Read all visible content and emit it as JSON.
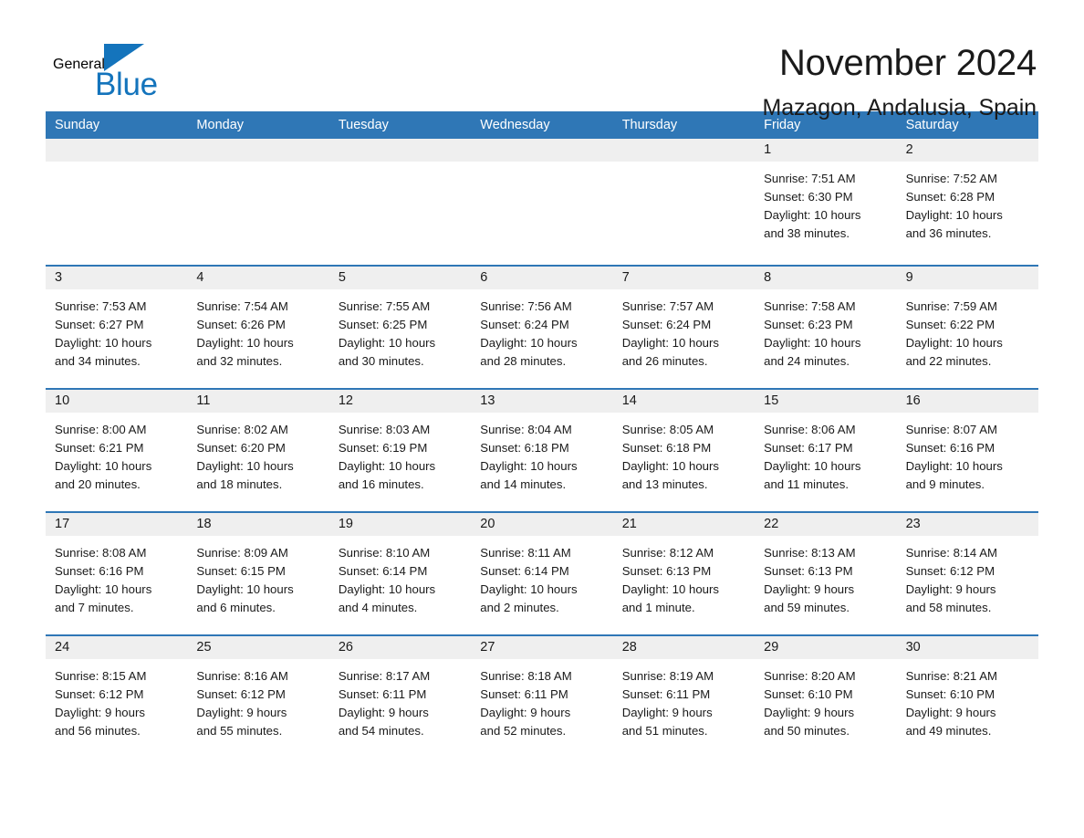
{
  "brand": {
    "name_part1": "General",
    "name_part2": "Blue",
    "triangle_color": "#1474bc",
    "logo_icon": "triangle-flag-icon"
  },
  "header": {
    "title": "November 2024",
    "subtitle": "Mazagon, Andalusia, Spain"
  },
  "theme": {
    "header_blue": "#2f77b6",
    "band_gray": "#efefef",
    "text_color": "#1a1a1a",
    "brand_blue": "#1474bc"
  },
  "weekday_headers": [
    "Sunday",
    "Monday",
    "Tuesday",
    "Wednesday",
    "Thursday",
    "Friday",
    "Saturday"
  ],
  "weeks": [
    [
      {
        "day": "",
        "empty": true,
        "lines": []
      },
      {
        "day": "",
        "empty": true,
        "lines": []
      },
      {
        "day": "",
        "empty": true,
        "lines": []
      },
      {
        "day": "",
        "empty": true,
        "lines": []
      },
      {
        "day": "",
        "empty": true,
        "lines": []
      },
      {
        "day": "1",
        "empty": false,
        "lines": [
          "Sunrise: 7:51 AM",
          "Sunset: 6:30 PM",
          "Daylight: 10 hours",
          "and 38 minutes."
        ]
      },
      {
        "day": "2",
        "empty": false,
        "lines": [
          "Sunrise: 7:52 AM",
          "Sunset: 6:28 PM",
          "Daylight: 10 hours",
          "and 36 minutes."
        ]
      }
    ],
    [
      {
        "day": "3",
        "empty": false,
        "lines": [
          "Sunrise: 7:53 AM",
          "Sunset: 6:27 PM",
          "Daylight: 10 hours",
          "and 34 minutes."
        ]
      },
      {
        "day": "4",
        "empty": false,
        "lines": [
          "Sunrise: 7:54 AM",
          "Sunset: 6:26 PM",
          "Daylight: 10 hours",
          "and 32 minutes."
        ]
      },
      {
        "day": "5",
        "empty": false,
        "lines": [
          "Sunrise: 7:55 AM",
          "Sunset: 6:25 PM",
          "Daylight: 10 hours",
          "and 30 minutes."
        ]
      },
      {
        "day": "6",
        "empty": false,
        "lines": [
          "Sunrise: 7:56 AM",
          "Sunset: 6:24 PM",
          "Daylight: 10 hours",
          "and 28 minutes."
        ]
      },
      {
        "day": "7",
        "empty": false,
        "lines": [
          "Sunrise: 7:57 AM",
          "Sunset: 6:24 PM",
          "Daylight: 10 hours",
          "and 26 minutes."
        ]
      },
      {
        "day": "8",
        "empty": false,
        "lines": [
          "Sunrise: 7:58 AM",
          "Sunset: 6:23 PM",
          "Daylight: 10 hours",
          "and 24 minutes."
        ]
      },
      {
        "day": "9",
        "empty": false,
        "lines": [
          "Sunrise: 7:59 AM",
          "Sunset: 6:22 PM",
          "Daylight: 10 hours",
          "and 22 minutes."
        ]
      }
    ],
    [
      {
        "day": "10",
        "empty": false,
        "lines": [
          "Sunrise: 8:00 AM",
          "Sunset: 6:21 PM",
          "Daylight: 10 hours",
          "and 20 minutes."
        ]
      },
      {
        "day": "11",
        "empty": false,
        "lines": [
          "Sunrise: 8:02 AM",
          "Sunset: 6:20 PM",
          "Daylight: 10 hours",
          "and 18 minutes."
        ]
      },
      {
        "day": "12",
        "empty": false,
        "lines": [
          "Sunrise: 8:03 AM",
          "Sunset: 6:19 PM",
          "Daylight: 10 hours",
          "and 16 minutes."
        ]
      },
      {
        "day": "13",
        "empty": false,
        "lines": [
          "Sunrise: 8:04 AM",
          "Sunset: 6:18 PM",
          "Daylight: 10 hours",
          "and 14 minutes."
        ]
      },
      {
        "day": "14",
        "empty": false,
        "lines": [
          "Sunrise: 8:05 AM",
          "Sunset: 6:18 PM",
          "Daylight: 10 hours",
          "and 13 minutes."
        ]
      },
      {
        "day": "15",
        "empty": false,
        "lines": [
          "Sunrise: 8:06 AM",
          "Sunset: 6:17 PM",
          "Daylight: 10 hours",
          "and 11 minutes."
        ]
      },
      {
        "day": "16",
        "empty": false,
        "lines": [
          "Sunrise: 8:07 AM",
          "Sunset: 6:16 PM",
          "Daylight: 10 hours",
          "and 9 minutes."
        ]
      }
    ],
    [
      {
        "day": "17",
        "empty": false,
        "lines": [
          "Sunrise: 8:08 AM",
          "Sunset: 6:16 PM",
          "Daylight: 10 hours",
          "and 7 minutes."
        ]
      },
      {
        "day": "18",
        "empty": false,
        "lines": [
          "Sunrise: 8:09 AM",
          "Sunset: 6:15 PM",
          "Daylight: 10 hours",
          "and 6 minutes."
        ]
      },
      {
        "day": "19",
        "empty": false,
        "lines": [
          "Sunrise: 8:10 AM",
          "Sunset: 6:14 PM",
          "Daylight: 10 hours",
          "and 4 minutes."
        ]
      },
      {
        "day": "20",
        "empty": false,
        "lines": [
          "Sunrise: 8:11 AM",
          "Sunset: 6:14 PM",
          "Daylight: 10 hours",
          "and 2 minutes."
        ]
      },
      {
        "day": "21",
        "empty": false,
        "lines": [
          "Sunrise: 8:12 AM",
          "Sunset: 6:13 PM",
          "Daylight: 10 hours",
          "and 1 minute."
        ]
      },
      {
        "day": "22",
        "empty": false,
        "lines": [
          "Sunrise: 8:13 AM",
          "Sunset: 6:13 PM",
          "Daylight: 9 hours",
          "and 59 minutes."
        ]
      },
      {
        "day": "23",
        "empty": false,
        "lines": [
          "Sunrise: 8:14 AM",
          "Sunset: 6:12 PM",
          "Daylight: 9 hours",
          "and 58 minutes."
        ]
      }
    ],
    [
      {
        "day": "24",
        "empty": false,
        "lines": [
          "Sunrise: 8:15 AM",
          "Sunset: 6:12 PM",
          "Daylight: 9 hours",
          "and 56 minutes."
        ]
      },
      {
        "day": "25",
        "empty": false,
        "lines": [
          "Sunrise: 8:16 AM",
          "Sunset: 6:12 PM",
          "Daylight: 9 hours",
          "and 55 minutes."
        ]
      },
      {
        "day": "26",
        "empty": false,
        "lines": [
          "Sunrise: 8:17 AM",
          "Sunset: 6:11 PM",
          "Daylight: 9 hours",
          "and 54 minutes."
        ]
      },
      {
        "day": "27",
        "empty": false,
        "lines": [
          "Sunrise: 8:18 AM",
          "Sunset: 6:11 PM",
          "Daylight: 9 hours",
          "and 52 minutes."
        ]
      },
      {
        "day": "28",
        "empty": false,
        "lines": [
          "Sunrise: 8:19 AM",
          "Sunset: 6:11 PM",
          "Daylight: 9 hours",
          "and 51 minutes."
        ]
      },
      {
        "day": "29",
        "empty": false,
        "lines": [
          "Sunrise: 8:20 AM",
          "Sunset: 6:10 PM",
          "Daylight: 9 hours",
          "and 50 minutes."
        ]
      },
      {
        "day": "30",
        "empty": false,
        "lines": [
          "Sunrise: 8:21 AM",
          "Sunset: 6:10 PM",
          "Daylight: 9 hours",
          "and 49 minutes."
        ]
      }
    ]
  ]
}
